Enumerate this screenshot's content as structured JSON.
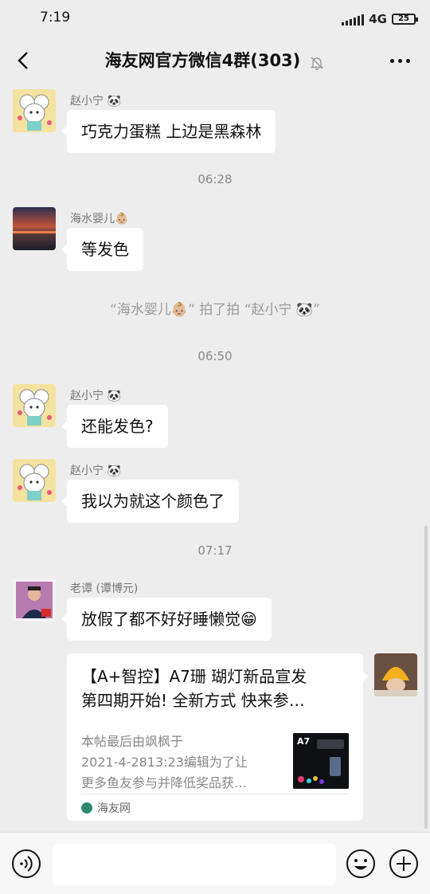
{
  "status_bar": {
    "time": "7:19",
    "network": "4G",
    "battery": "25"
  },
  "header": {
    "title": "海友网官方微信4群(303)",
    "icons": {
      "back": "chevron-left-icon",
      "mute": "bell-off-icon",
      "more": "more-dots-icon"
    }
  },
  "messages": [
    {
      "sender": "赵小宁 🐼",
      "text": "巧克力蛋糕 上边是黑森林"
    },
    {
      "timestamp": "06:28"
    },
    {
      "sender": "海水婴儿👶🏼",
      "text": "等发色"
    },
    {
      "system": "“海水婴儿👶🏼” 拍了拍 “赵小宁 🐼”"
    },
    {
      "timestamp": "06:50"
    },
    {
      "sender": "赵小宁 🐼",
      "text": "还能发色?"
    },
    {
      "sender": "赵小宁 🐼",
      "text": "我以为就这个颜色了"
    },
    {
      "timestamp": "07:17"
    },
    {
      "sender": "老谭 (谭博元)",
      "text": "放假了都不好好睡懒觉😁"
    }
  ],
  "link_card": {
    "title_lines": [
      "【A+智控】A7珊 瑚灯新品宣发",
      "第四期开始! 全新方式 快来参…"
    ],
    "desc_lines": [
      "本帖最后由飒枫于",
      "2021-4-2813:23编辑为了让",
      "更多鱼友参与并降低奖品获…"
    ],
    "thumb_label": "A7",
    "source": "海友网"
  },
  "input_bar": {
    "placeholder": "",
    "icons": {
      "voice": "voice-icon",
      "emoji": "emoji-icon",
      "plus": "plus-icon"
    }
  },
  "colors": {
    "background": "#ededed",
    "bubble": "#ffffff",
    "meta_text": "#888888"
  }
}
